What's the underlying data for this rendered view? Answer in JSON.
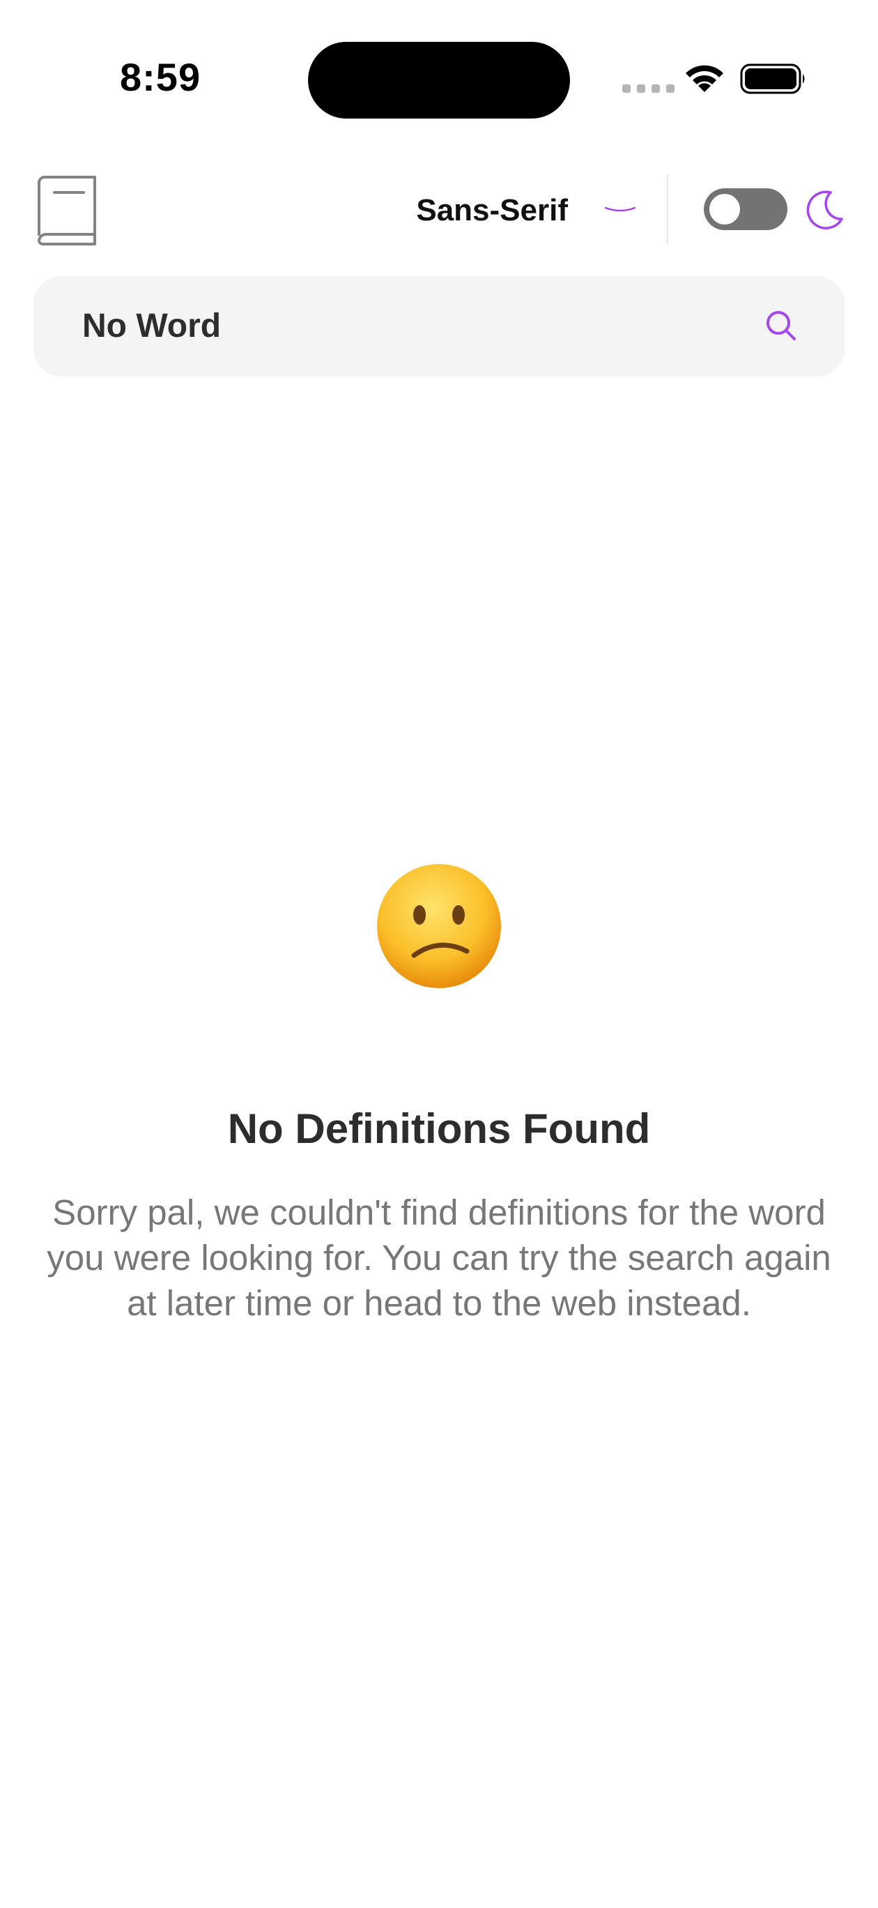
{
  "status_bar": {
    "time": "8:59",
    "icons": [
      "signal-dots-icon",
      "wifi-icon",
      "battery-icon"
    ]
  },
  "header": {
    "logo_icon": "book-icon",
    "font_selector": {
      "value": "Sans-Serif",
      "icon": "chevron-down-icon"
    },
    "dark_mode_toggle": {
      "on": false,
      "icon": "moon-icon"
    }
  },
  "search": {
    "value": "No Word",
    "icon": "search-icon"
  },
  "empty_state": {
    "emoji": "😕",
    "title": "No Definitions Found",
    "message": "Sorry pal, we couldn't find definitions for the word you were looking for. You can try the search again at later time or head to the web instead."
  },
  "colors": {
    "accent": "#a445ed",
    "toggle_off": "#737373",
    "search_bg": "#f4f4f4",
    "text_primary": "#2d2d2d",
    "text_secondary": "#777777"
  }
}
